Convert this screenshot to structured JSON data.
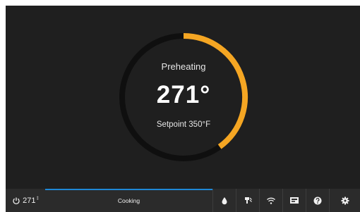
{
  "oven": {
    "status": "Preheating",
    "temperature": "271°",
    "setpoint": "Setpoint 350°F",
    "preheat_progress": 0.4
  },
  "colors": {
    "accent": "#f5a623",
    "track": "#0f0f0f",
    "background": "#1f1f1f",
    "bar": "#2b2b2b",
    "progress": "#1e88d6"
  },
  "bottom_bar": {
    "temp_readout": "271",
    "temp_unit_mark": "‡",
    "cooking_label": "Cooking",
    "icons": [
      "power-icon",
      "water-drop-icon",
      "probe-icon",
      "wifi-icon",
      "display-icon",
      "help-icon",
      "settings-gear-icon"
    ]
  }
}
